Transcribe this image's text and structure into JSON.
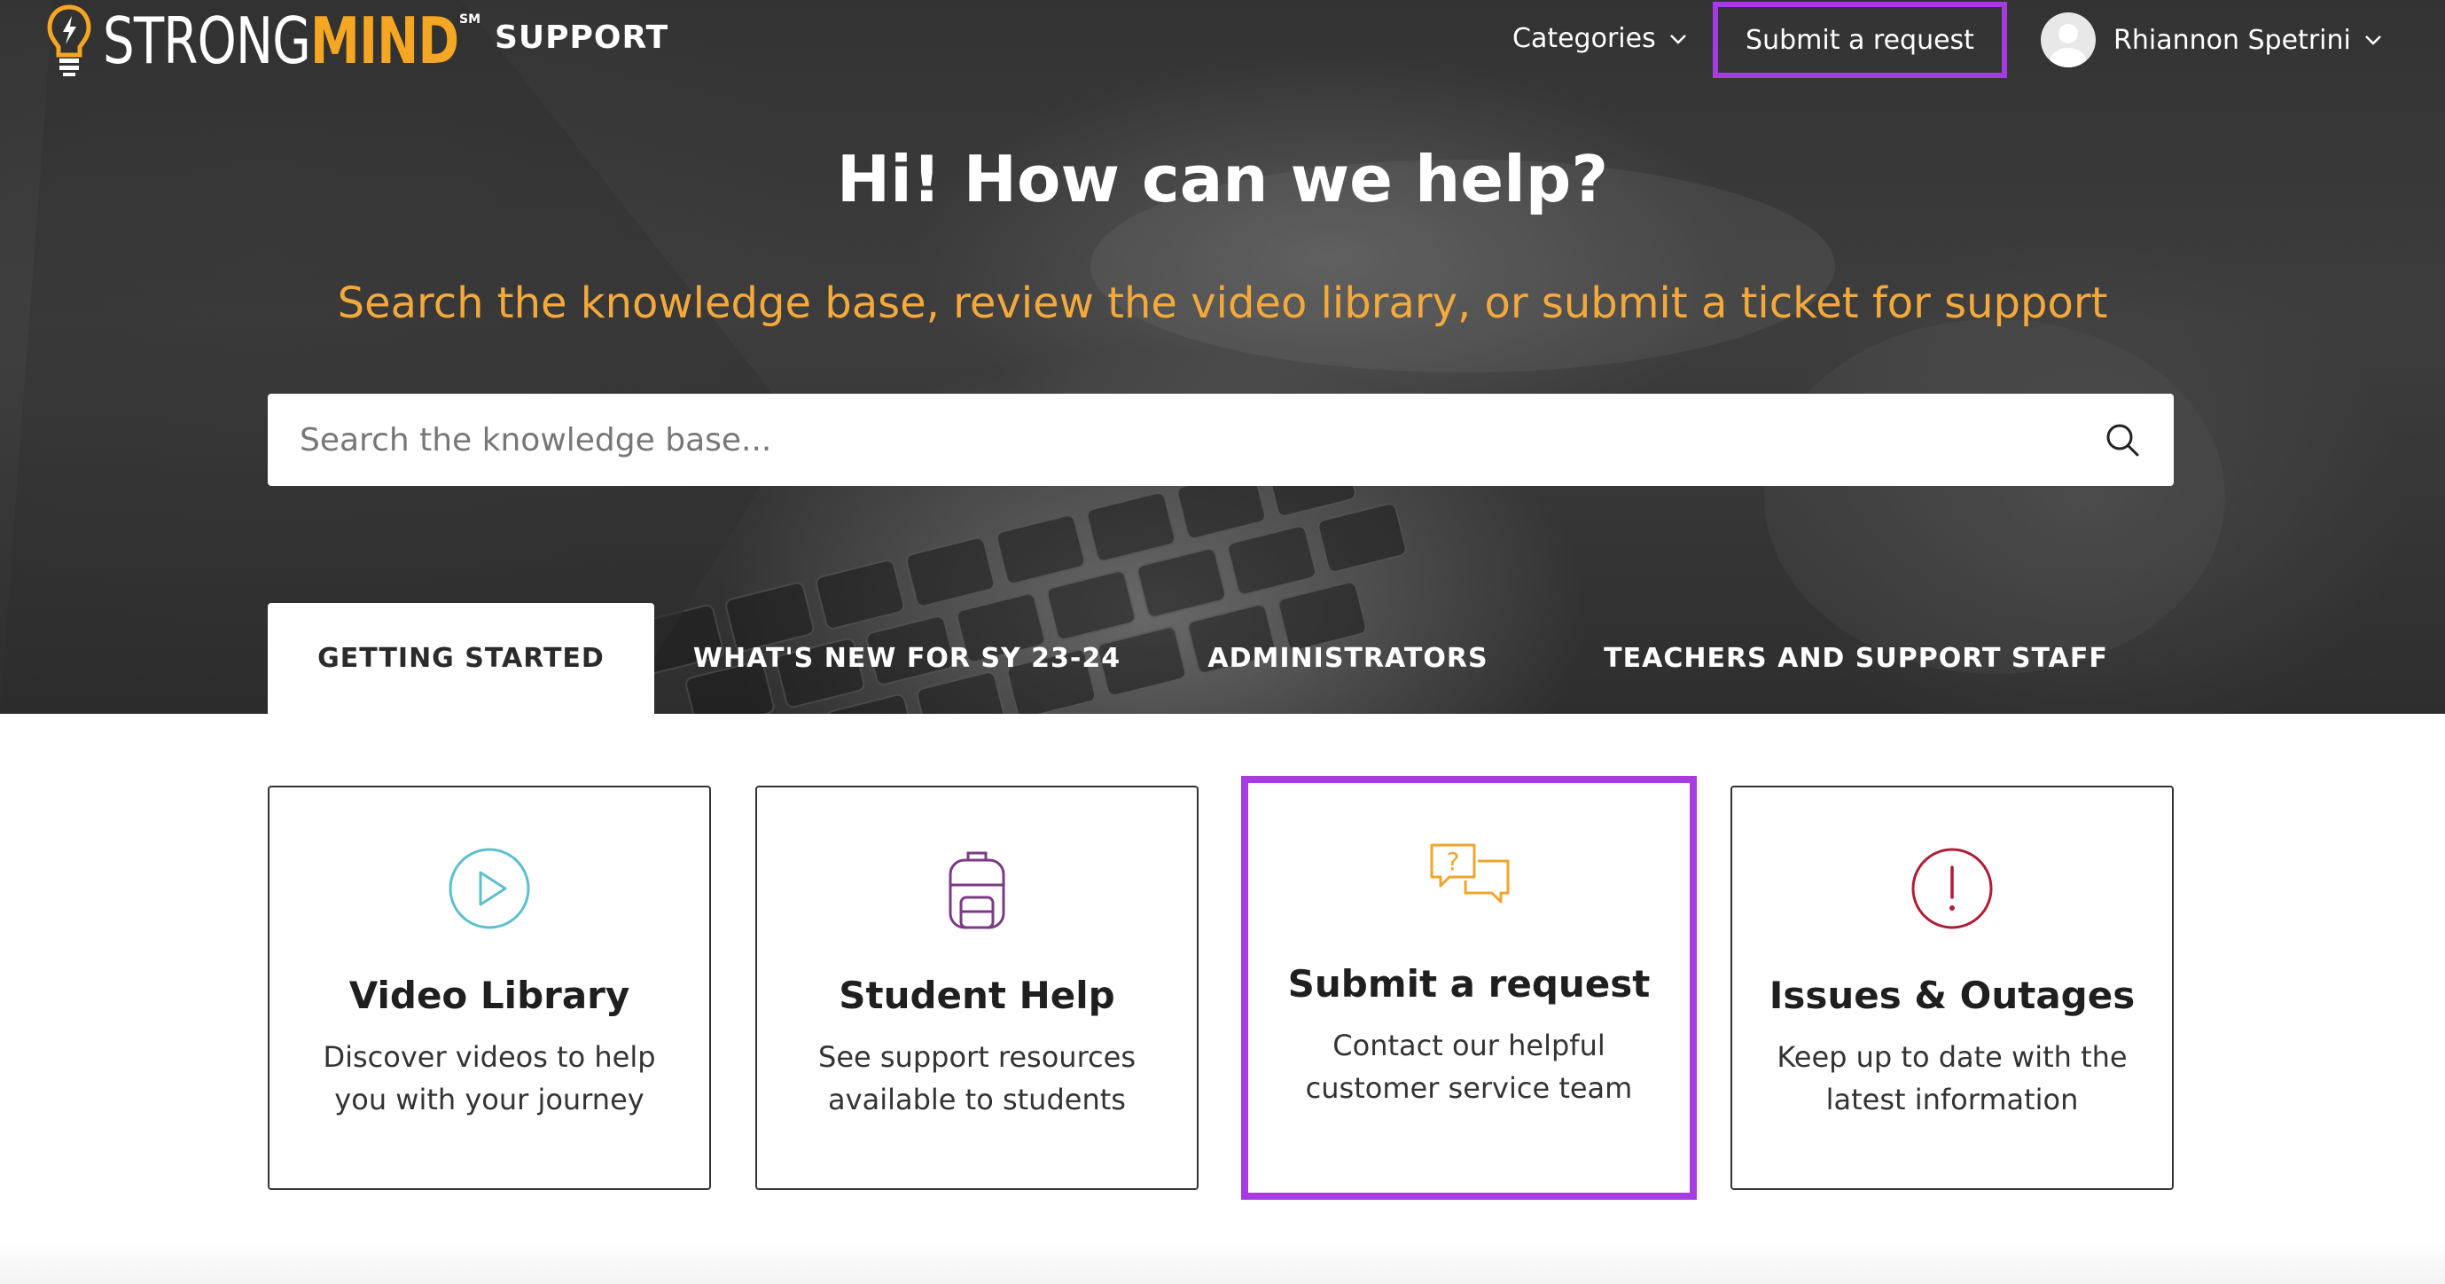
{
  "brand": {
    "logo_strong": "STRONG",
    "logo_mind": "MIND",
    "logo_sm": "SM",
    "section": "SUPPORT"
  },
  "nav": {
    "categories": "Categories",
    "submit_request": "Submit a request",
    "user_name": "Rhiannon Spetrini"
  },
  "hero": {
    "title": "Hi! How can we help?",
    "subtitle": "Search the knowledge base, review the video library, or submit a ticket for support"
  },
  "search": {
    "placeholder": "Search the knowledge base...",
    "value": ""
  },
  "tabs": [
    {
      "label": "GETTING STARTED",
      "active": true
    },
    {
      "label": "WHAT'S NEW FOR SY 23-24",
      "active": false
    },
    {
      "label": "ADMINISTRATORS",
      "active": false
    },
    {
      "label": "TEACHERS AND SUPPORT STAFF",
      "active": false
    }
  ],
  "cards": [
    {
      "title": "Video Library",
      "desc_line1": "Discover videos to help",
      "desc_line2": "you with your journey",
      "icon": "play-circle-icon",
      "color": "#5bbfcf"
    },
    {
      "title": "Student Help",
      "desc_line1": "See support resources",
      "desc_line2": "available to students",
      "icon": "backpack-icon",
      "color": "#7a3a84"
    },
    {
      "title": "Submit a request",
      "desc_line1": "Contact our helpful",
      "desc_line2": "customer service team",
      "icon": "chat-bubbles-icon",
      "color": "#f0a52e"
    },
    {
      "title": "Issues & Outages",
      "desc_line1": "Keep up to date with the",
      "desc_line2": "latest information",
      "icon": "alert-circle-icon",
      "color": "#b01c36"
    }
  ],
  "colors": {
    "accent_highlight": "#a53be0",
    "brand_orange": "#f5a623",
    "subtitle_orange": "#f3a93b"
  }
}
